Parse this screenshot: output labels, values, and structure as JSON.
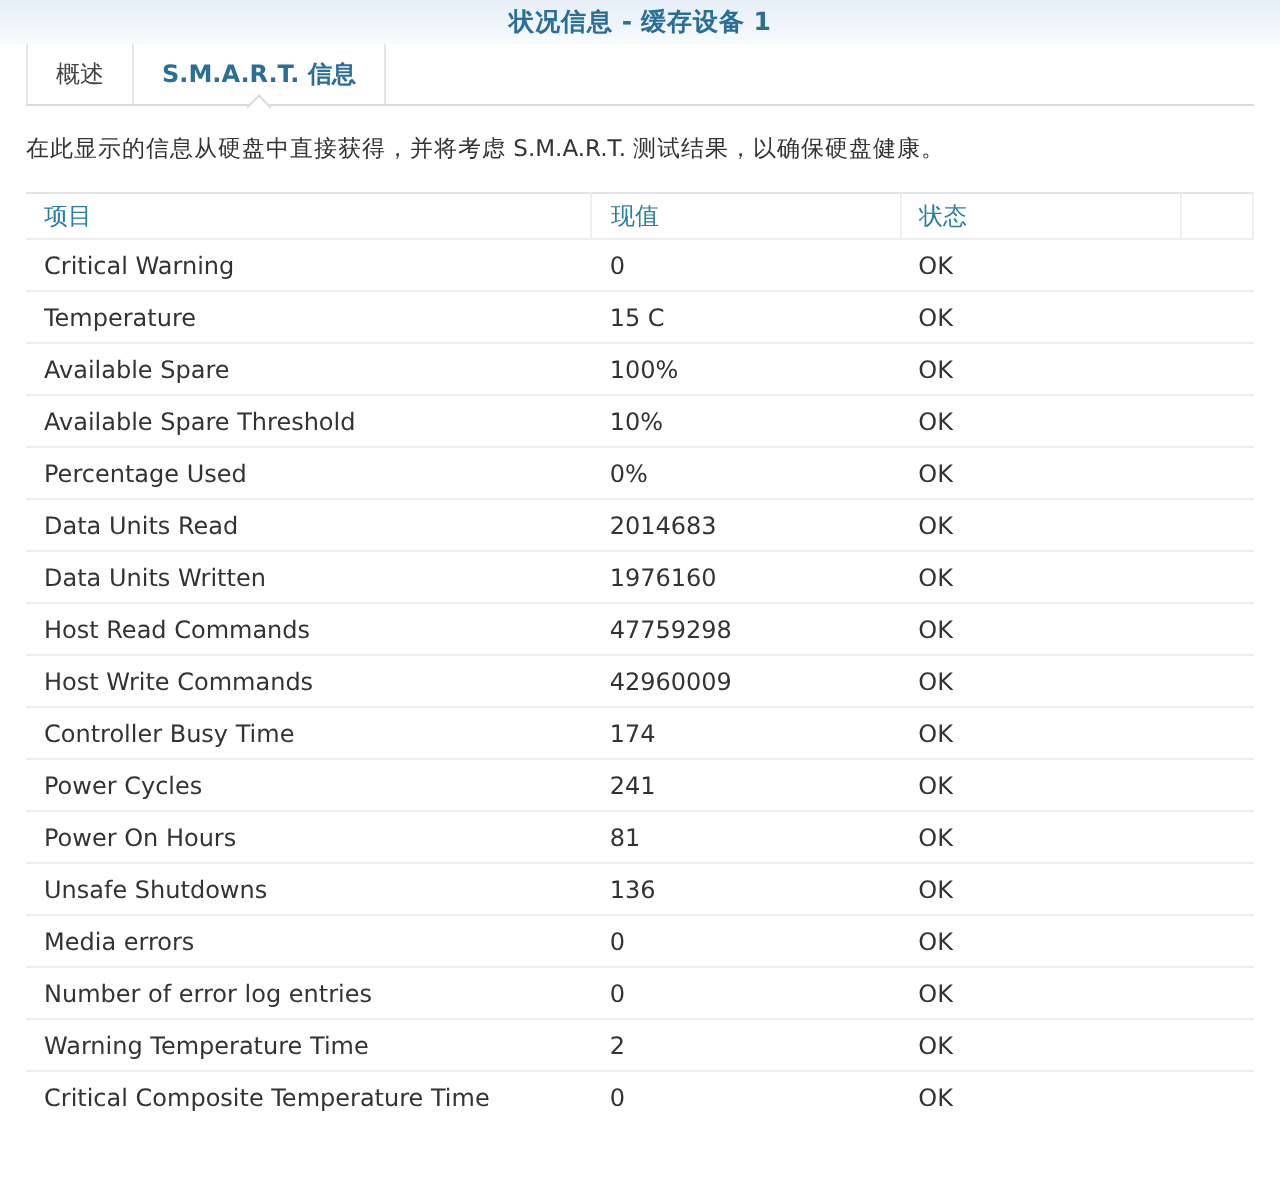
{
  "window": {
    "title": "状况信息 - 缓存设备 1"
  },
  "tabs": [
    {
      "label": "概述",
      "selected": false
    },
    {
      "label": "S.M.A.R.T. 信息",
      "selected": true
    }
  ],
  "description": "在此显示的信息从硬盘中直接获得，并将考虑 S.M.A.R.T. 测试结果，以确保硬盘健康。",
  "table": {
    "columns": [
      "项目",
      "现值",
      "状态"
    ],
    "rows": [
      [
        "Critical Warning",
        "0",
        "OK"
      ],
      [
        "Temperature",
        "15 C",
        "OK"
      ],
      [
        "Available Spare",
        "100%",
        "OK"
      ],
      [
        "Available Spare Threshold",
        "10%",
        "OK"
      ],
      [
        "Percentage Used",
        "0%",
        "OK"
      ],
      [
        "Data Units Read",
        "2014683",
        "OK"
      ],
      [
        "Data Units Written",
        "1976160",
        "OK"
      ],
      [
        "Host Read Commands",
        "47759298",
        "OK"
      ],
      [
        "Host Write Commands",
        "42960009",
        "OK"
      ],
      [
        "Controller Busy Time",
        "174",
        "OK"
      ],
      [
        "Power Cycles",
        "241",
        "OK"
      ],
      [
        "Power On Hours",
        "81",
        "OK"
      ],
      [
        "Unsafe Shutdowns",
        "136",
        "OK"
      ],
      [
        "Media errors",
        "0",
        "OK"
      ],
      [
        "Number of error log entries",
        "0",
        "OK"
      ],
      [
        "Warning Temperature Time",
        "2",
        "OK"
      ],
      [
        "Critical Composite Temperature Time",
        "0",
        "OK"
      ]
    ]
  }
}
